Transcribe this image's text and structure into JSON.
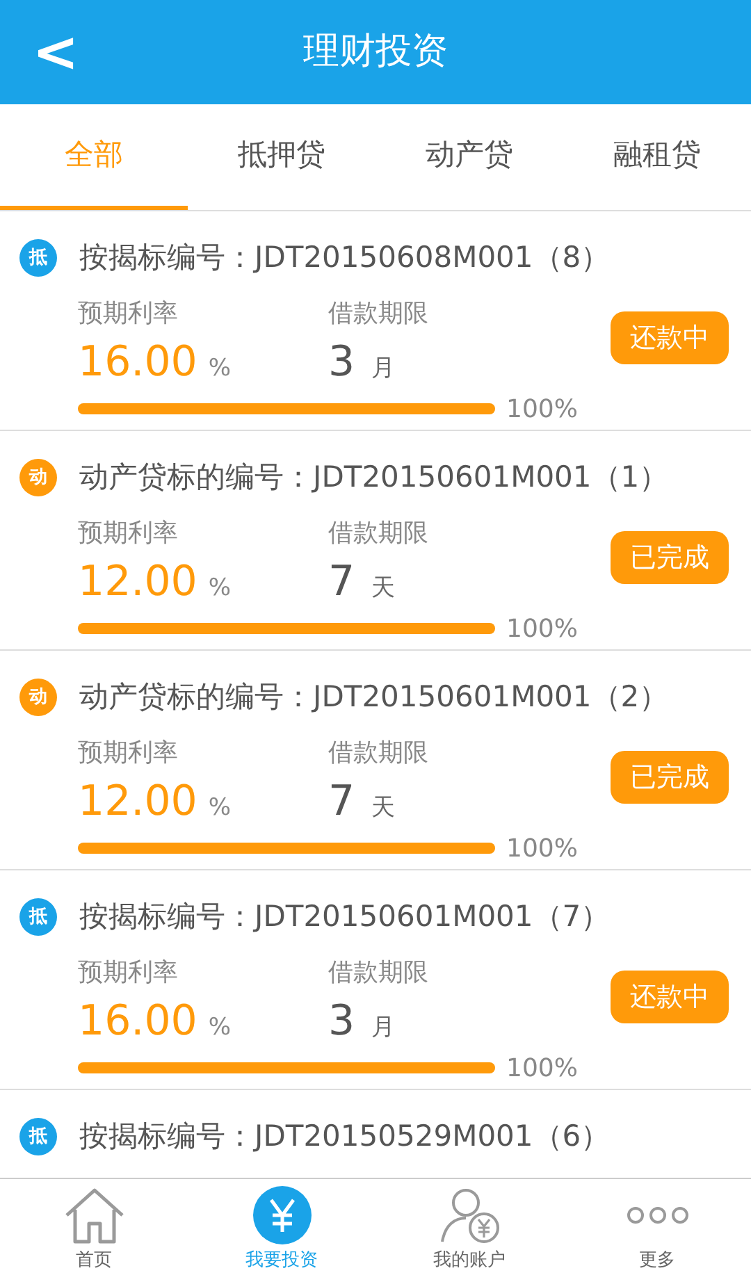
{
  "header": {
    "back": "<",
    "title": "理财投资"
  },
  "tabs": [
    {
      "label": "全部",
      "selected": true
    },
    {
      "label": "抵押贷",
      "selected": false
    },
    {
      "label": "动产贷",
      "selected": false
    },
    {
      "label": "融租贷",
      "selected": false
    }
  ],
  "loans": [
    {
      "tag": "抵",
      "color": "#1aa3e8",
      "title": "按揭标编号：JDT20150608M001（8）",
      "rate_label": "预期利率",
      "rate": "16.00",
      "rate_unit": "%",
      "term_label": "借款期限",
      "term": "3",
      "term_unit": "月",
      "status": "还款中",
      "level": 1,
      "progress": "100%"
    },
    {
      "tag": "动",
      "color": "#ff9a0a",
      "title": "动产贷标的编号：JDT20150601M001（1）",
      "rate_label": "预期利率",
      "rate": "12.00",
      "rate_unit": "%",
      "term_label": "借款期限",
      "term": "7",
      "term_unit": "天",
      "status": "已完成",
      "level": 1,
      "progress": "100%"
    },
    {
      "tag": "动",
      "color": "#ff9a0a",
      "title": "动产贷标的编号：JDT20150601M001（2）",
      "rate_label": "预期利率",
      "rate": "12.00",
      "rate_unit": "%",
      "term_label": "借款期限",
      "term": "7",
      "term_unit": "天",
      "status": "已完成",
      "level": 1,
      "progress": "100%"
    },
    {
      "tag": "抵",
      "color": "#1aa3e8",
      "title": "按揭标编号：JDT20150601M001（7）",
      "rate_label": "预期利率",
      "rate": "16.00",
      "rate_unit": "%",
      "term_label": "借款期限",
      "term": "3",
      "term_unit": "月",
      "status": "还款中",
      "level": 1,
      "progress": "100%"
    },
    {
      "tag": "抵",
      "color": "#1aa3e8",
      "title": "按揭标编号：JDT20150529M001（6）"
    }
  ],
  "nav": [
    {
      "label": "首页",
      "kind": "home",
      "selected": false
    },
    {
      "label": "我要投资",
      "kind": "invest",
      "selected": true
    },
    {
      "label": "我的账户",
      "kind": "account",
      "selected": false
    },
    {
      "label": "更多",
      "kind": "more",
      "selected": false
    }
  ]
}
